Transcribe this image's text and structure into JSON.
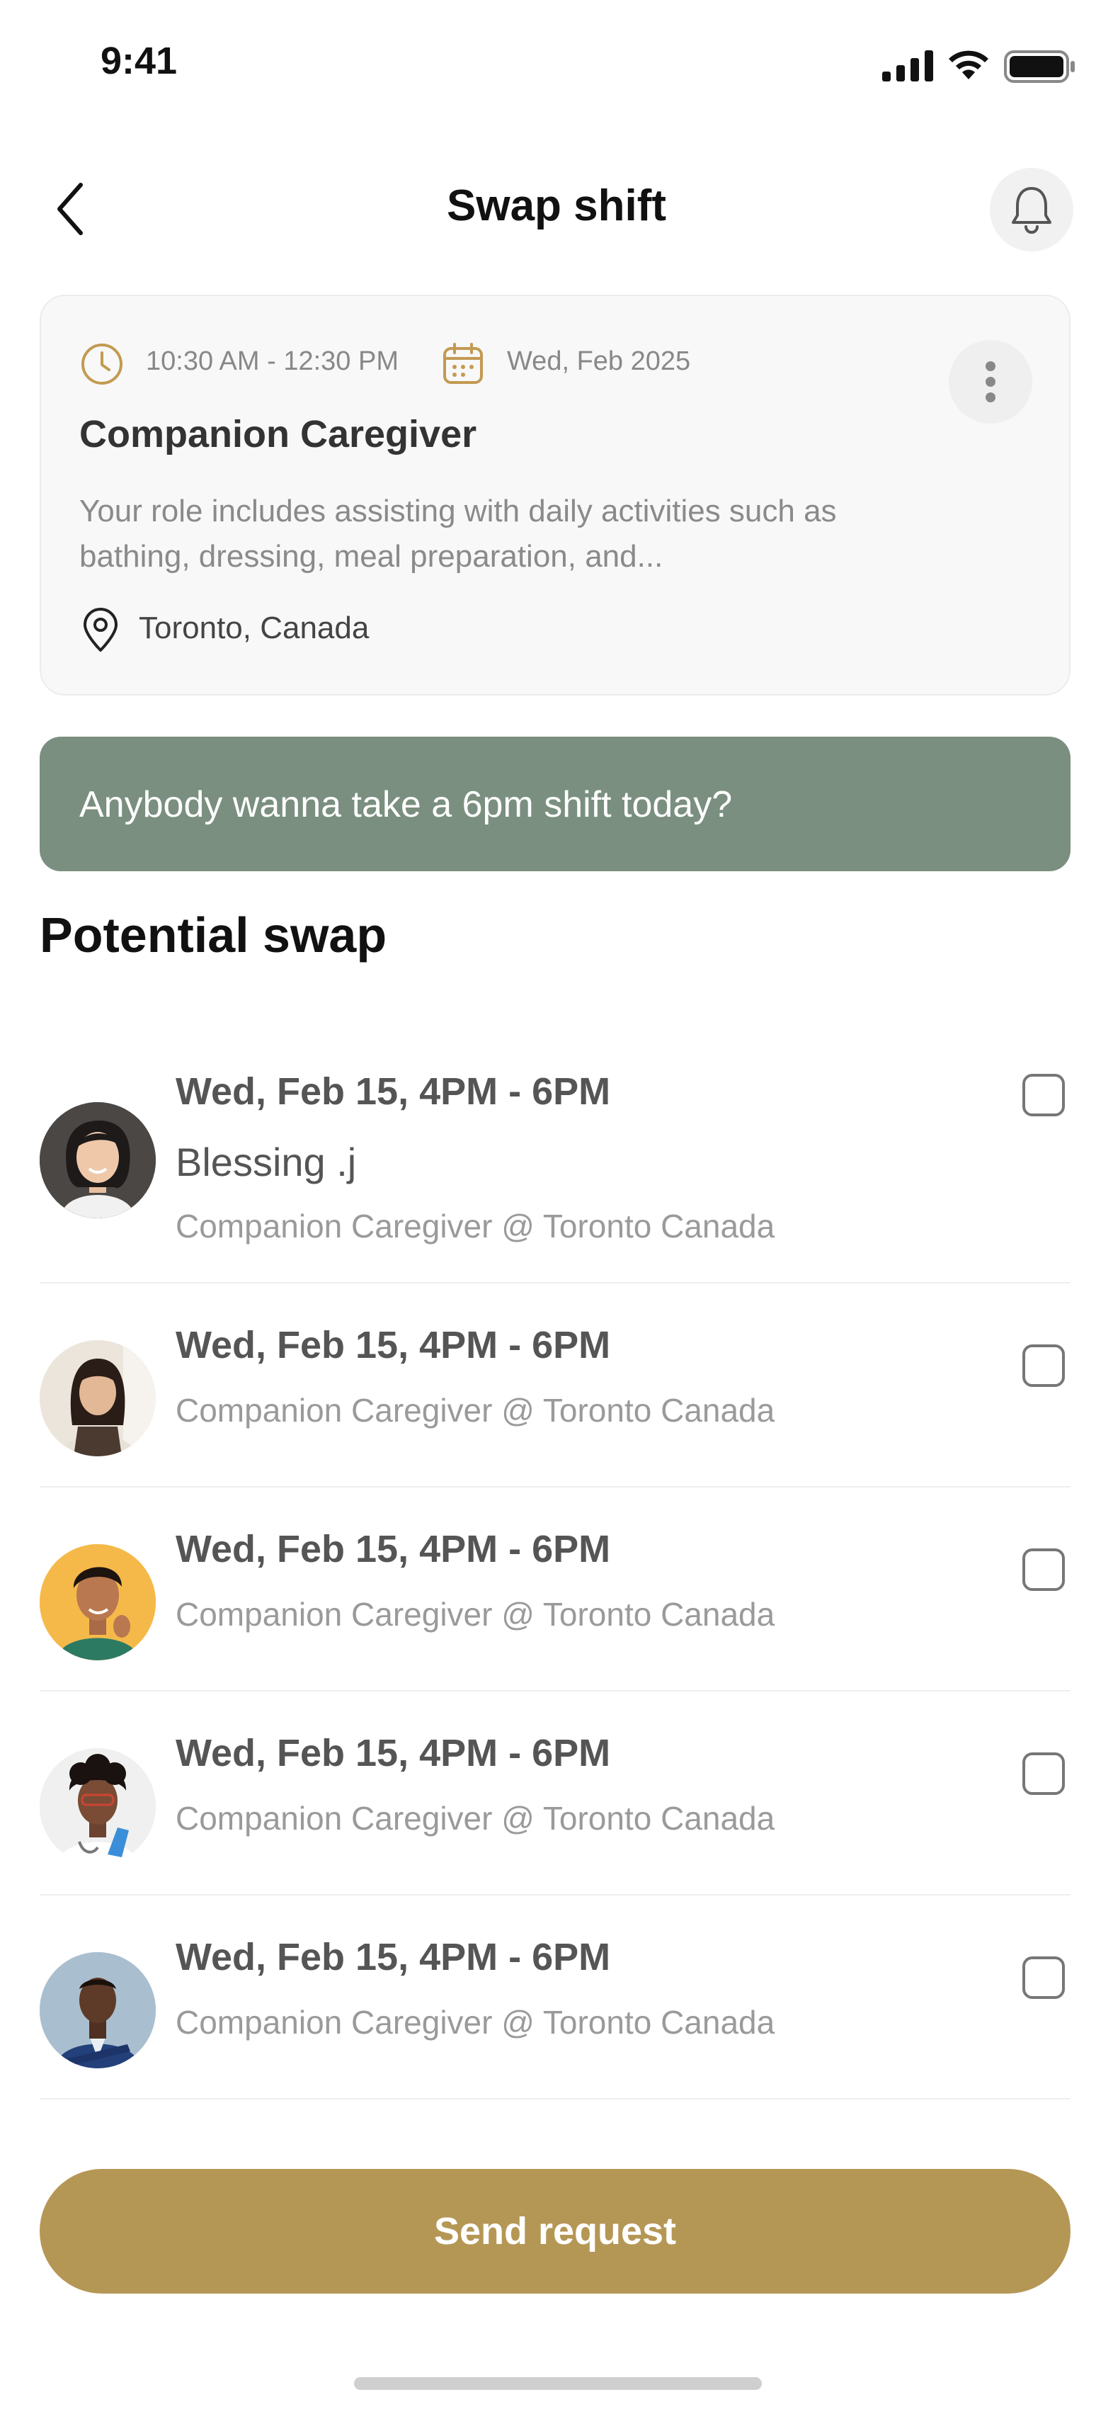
{
  "status_bar": {
    "time": "9:41"
  },
  "header": {
    "title": "Swap shift"
  },
  "shift_card": {
    "time_range": "10:30 AM - 12:30 PM",
    "date": "Wed, Feb 2025",
    "role": "Companion Caregiver",
    "description": "Your role includes assisting with daily activities such as bathing, dressing, meal preparation, and...",
    "location": "Toronto, Canada"
  },
  "message": {
    "text": "Anybody wanna take a 6pm shift today?"
  },
  "section": {
    "title": "Potential swap"
  },
  "swaps": [
    {
      "date": "Wed, Feb 15, 4PM - 6PM",
      "name": "Blessing .j",
      "subtitle": "Companion Caregiver @ Toronto Canada",
      "checked": false
    },
    {
      "date": "Wed, Feb 15, 4PM - 6PM",
      "subtitle": "Companion Caregiver @ Toronto Canada",
      "checked": false
    },
    {
      "date": "Wed, Feb 15, 4PM - 6PM",
      "subtitle": "Companion Caregiver @ Toronto Canada",
      "checked": false
    },
    {
      "date": "Wed, Feb 15, 4PM - 6PM",
      "subtitle": "Companion Caregiver @ Toronto Canada",
      "checked": false
    },
    {
      "date": "Wed, Feb 15, 4PM - 6PM",
      "subtitle": "Companion Caregiver @ Toronto Canada",
      "checked": false
    }
  ],
  "actions": {
    "send_label": "Send request"
  },
  "colors": {
    "accent": "#b59755",
    "banner": "#7a8f7f",
    "icon_gold": "#c39a52"
  }
}
